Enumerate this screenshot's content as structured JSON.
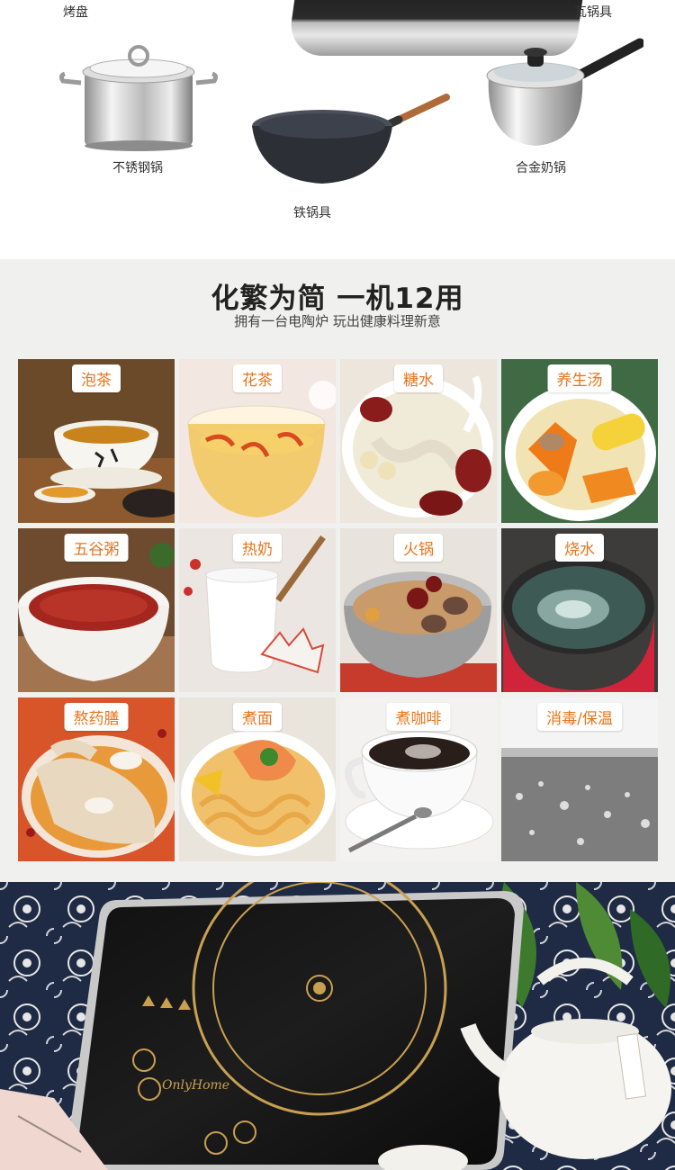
{
  "cookware": {
    "bakeware_label": "烤盘",
    "clay_pot_label": "瓦锅具",
    "stainless_pot_label": "不锈钢锅",
    "iron_wok_label": "铁锅具",
    "alloy_milk_pan_label": "合金奶锅"
  },
  "uses": {
    "title": "化繁为简 一机12用",
    "subtitle": "拥有一台电陶炉 玩出健康料理新意",
    "items": [
      {
        "label": "泡茶",
        "icon": "tea-cup"
      },
      {
        "label": "花茶",
        "icon": "flower-tea"
      },
      {
        "label": "糖水",
        "icon": "sweet-soup"
      },
      {
        "label": "养生汤",
        "icon": "health-soup"
      },
      {
        "label": "五谷粥",
        "icon": "grain-porridge"
      },
      {
        "label": "热奶",
        "icon": "hot-milk"
      },
      {
        "label": "火锅",
        "icon": "hot-pot"
      },
      {
        "label": "烧水",
        "icon": "boiling-water"
      },
      {
        "label": "熬药膳",
        "icon": "herbal-soup"
      },
      {
        "label": "煮面",
        "icon": "noodles"
      },
      {
        "label": "煮咖啡",
        "icon": "coffee"
      },
      {
        "label": "消毒/保温",
        "icon": "sterilize"
      }
    ]
  },
  "hero": {
    "brand_text": "OnlyHome"
  },
  "colors": {
    "accent_orange": "#e8741c",
    "grid_background": "#f0f0ee",
    "hero_cloth": "#1f2a44"
  }
}
